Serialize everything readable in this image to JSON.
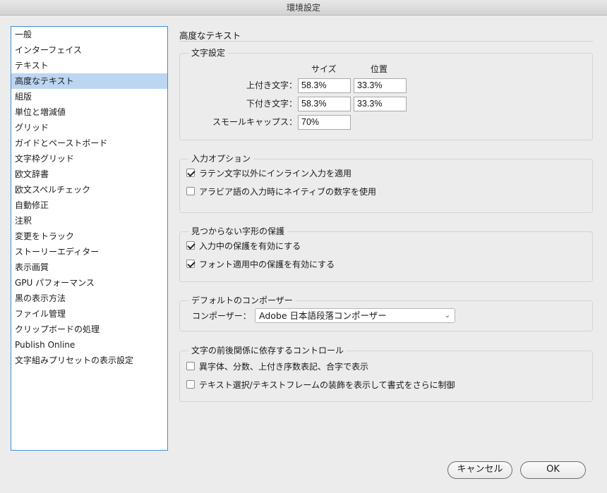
{
  "window": {
    "title": "環境設定"
  },
  "sidebar": {
    "items": [
      {
        "label": "一般"
      },
      {
        "label": "インターフェイス"
      },
      {
        "label": "テキスト"
      },
      {
        "label": "高度なテキスト",
        "selected": true
      },
      {
        "label": "組版"
      },
      {
        "label": "単位と増減値"
      },
      {
        "label": "グリッド"
      },
      {
        "label": "ガイドとペーストボード"
      },
      {
        "label": "文字枠グリッド"
      },
      {
        "label": "欧文辞書"
      },
      {
        "label": "欧文スペルチェック"
      },
      {
        "label": "自動修正"
      },
      {
        "label": "注釈"
      },
      {
        "label": "変更をトラック"
      },
      {
        "label": "ストーリーエディター"
      },
      {
        "label": "表示画質"
      },
      {
        "label": "GPU パフォーマンス"
      },
      {
        "label": "黒の表示方法"
      },
      {
        "label": "ファイル管理"
      },
      {
        "label": "クリップボードの処理"
      },
      {
        "label": "Publish Online"
      },
      {
        "label": "文字組みプリセットの表示設定"
      }
    ]
  },
  "main": {
    "title": "高度なテキスト",
    "char_settings": {
      "legend": "文字設定",
      "col_size": "サイズ",
      "col_position": "位置",
      "superscript": {
        "label": "上付き文字：",
        "size": "58.3%",
        "position": "33.3%"
      },
      "subscript": {
        "label": "下付き文字：",
        "size": "58.3%",
        "position": "33.3%"
      },
      "small_caps": {
        "label": "スモールキャップス：",
        "size": "70%"
      }
    },
    "input_options": {
      "legend": "入力オプション",
      "inline_input": {
        "label": "ラテン文字以外にインライン入力を適用",
        "checked": true
      },
      "arabic_native_digits": {
        "label": "アラビア語の入力時にネイティブの数字を使用",
        "checked": false
      }
    },
    "missing_glyph": {
      "legend": "見つからない字形の保護",
      "protect_typing": {
        "label": "入力中の保護を有効にする",
        "checked": true
      },
      "protect_font": {
        "label": "フォント適用中の保護を有効にする",
        "checked": true
      }
    },
    "default_composer": {
      "legend": "デフォルトのコンポーザー",
      "label": "コンポーザー：",
      "value": "Adobe 日本語段落コンポーザー"
    },
    "contextual_controls": {
      "legend": "文字の前後関係に依存するコントロール",
      "show_alternates": {
        "label": "異字体、分数、上付き序数表記、合字で表示",
        "checked": false
      },
      "text_selection": {
        "label": "テキスト選択/テキストフレームの装飾を表示して書式をさらに制御",
        "checked": false
      }
    }
  },
  "footer": {
    "cancel": "キャンセル",
    "ok": "OK"
  },
  "colors": {
    "selection": "#bcd6f2",
    "focus_border": "#3f8fd6"
  }
}
